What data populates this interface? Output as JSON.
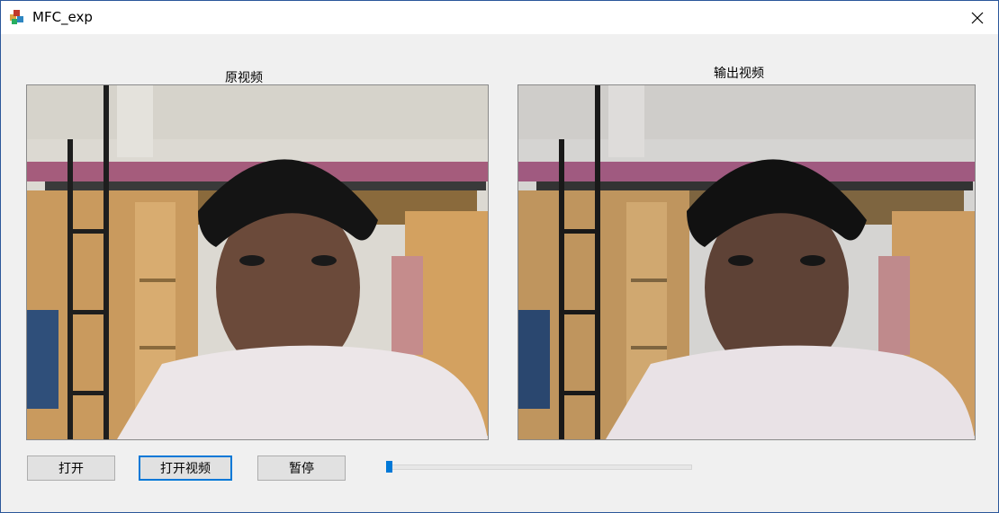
{
  "window": {
    "title": "MFC_exp",
    "icon": "mfc-app-icon",
    "close_icon": "close-icon"
  },
  "videos": {
    "original_label": "原视频",
    "output_label": "输出视频"
  },
  "buttons": {
    "open": "打开",
    "open_video": "打开视频",
    "pause": "暂停"
  },
  "slider": {
    "position_percent": 0
  },
  "colors": {
    "accent": "#0078d7",
    "window_border": "#2b579a",
    "button_face": "#e1e1e1"
  }
}
